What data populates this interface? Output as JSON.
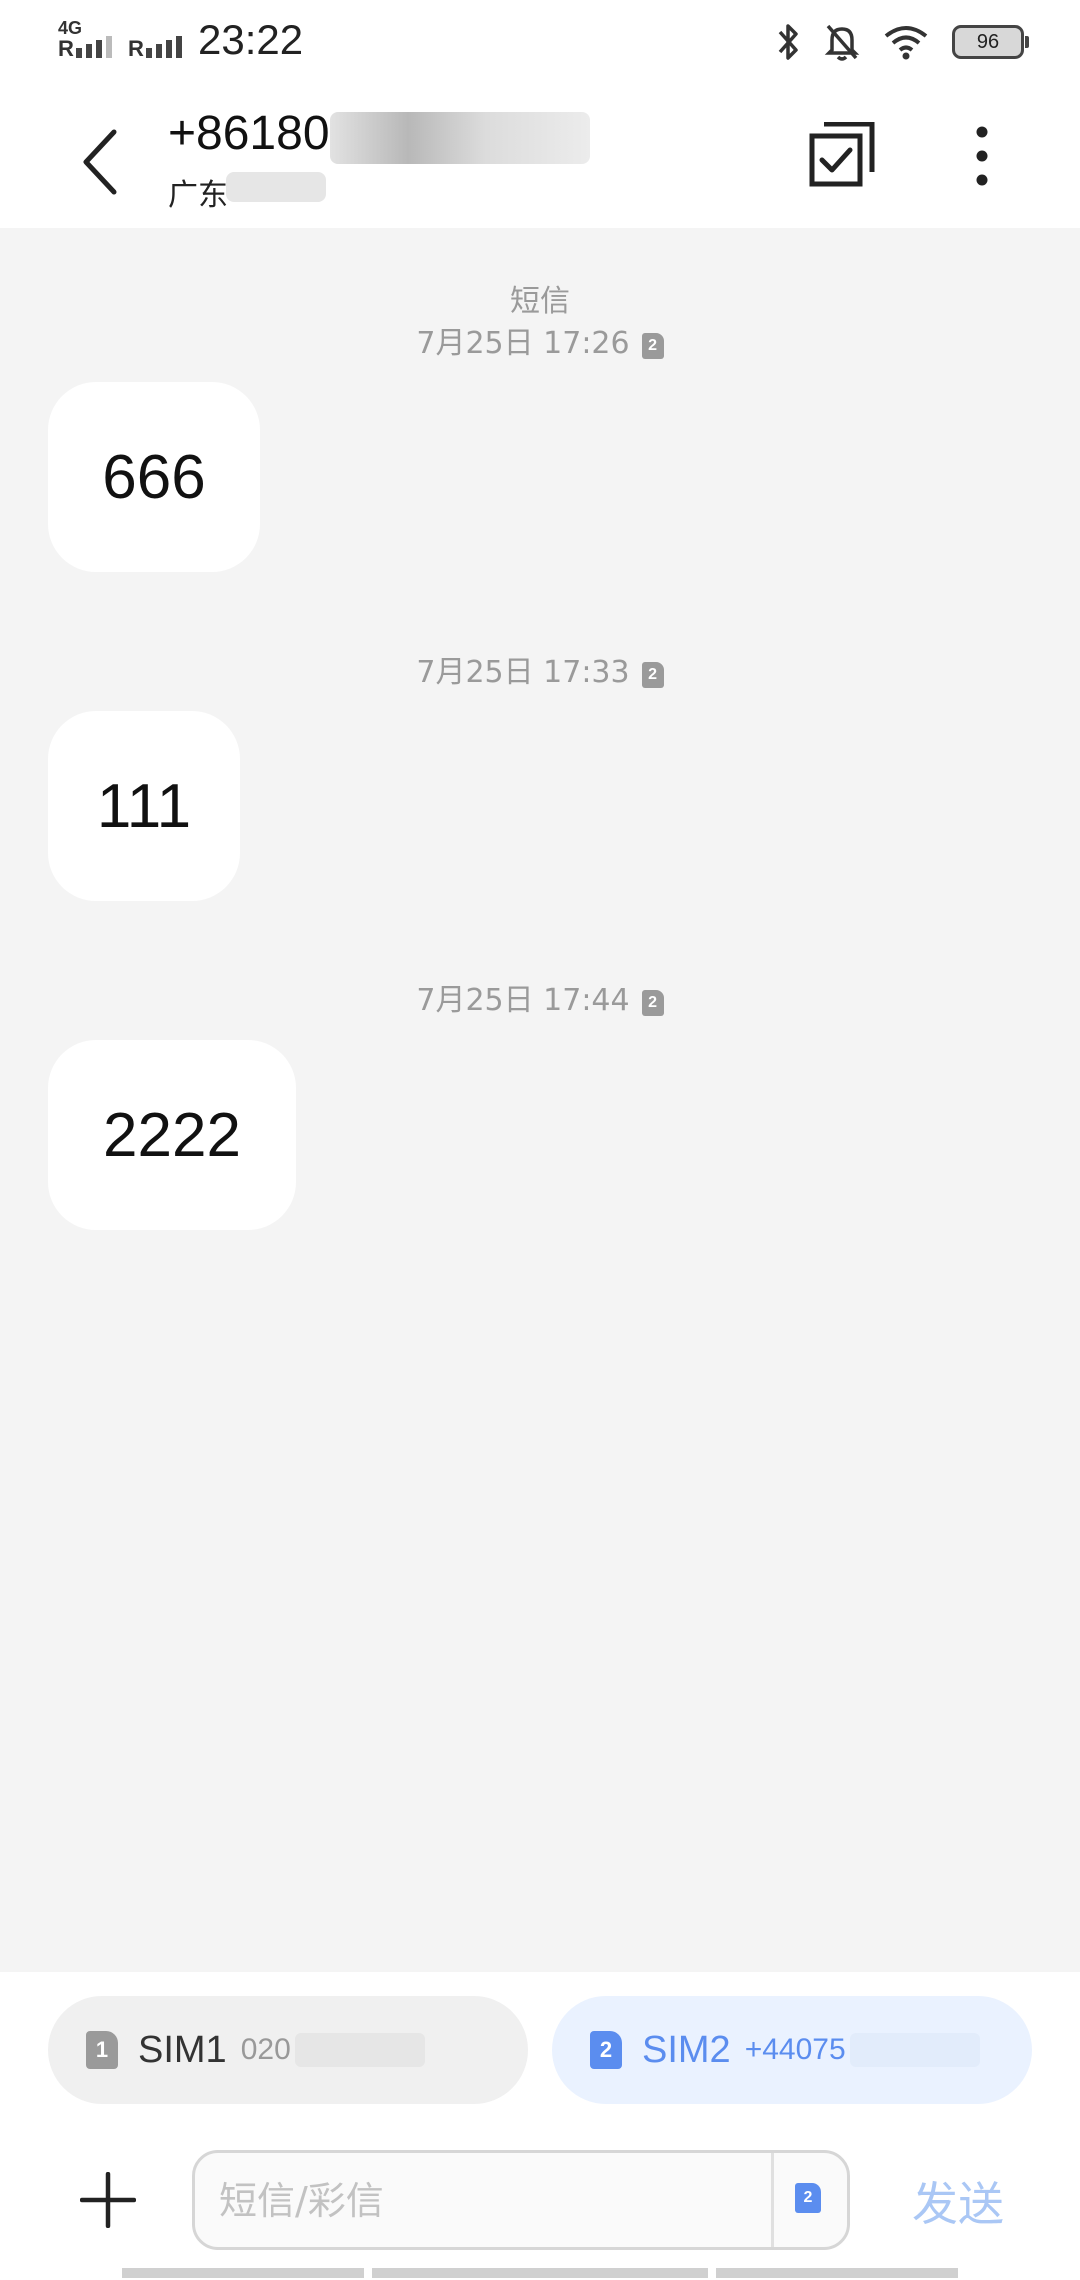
{
  "status_bar": {
    "network_type": "4G",
    "roaming_1": "R",
    "roaming_2": "R",
    "time": "23:22",
    "battery": "96",
    "icons": [
      "bluetooth-icon",
      "bell-off-icon",
      "wifi-icon",
      "battery-icon"
    ]
  },
  "header": {
    "phone_number": "+86180",
    "location": "广东",
    "icons": [
      "back-icon",
      "select-icon",
      "more-icon"
    ]
  },
  "conversation": {
    "type_label": "短信",
    "messages": [
      {
        "timestamp": "7月25日 17:26",
        "sim": "2",
        "text": "666"
      },
      {
        "timestamp": "7月25日 17:33",
        "sim": "2",
        "text": "111"
      },
      {
        "timestamp": "7月25日 17:44",
        "sim": "2",
        "text": "2222"
      }
    ]
  },
  "sim_selector": {
    "sim1": {
      "badge": "1",
      "label": "SIM1",
      "number": "020"
    },
    "sim2": {
      "badge": "2",
      "label": "SIM2",
      "number": "+44075"
    },
    "selected": "sim2"
  },
  "composer": {
    "placeholder": "短信/彩信",
    "sim_badge": "2",
    "send_label": "发送"
  },
  "colors": {
    "accent": "#5b8def",
    "send_disabled": "#aac7f5",
    "background": "#f4f4f4",
    "bubble": "#ffffff"
  }
}
